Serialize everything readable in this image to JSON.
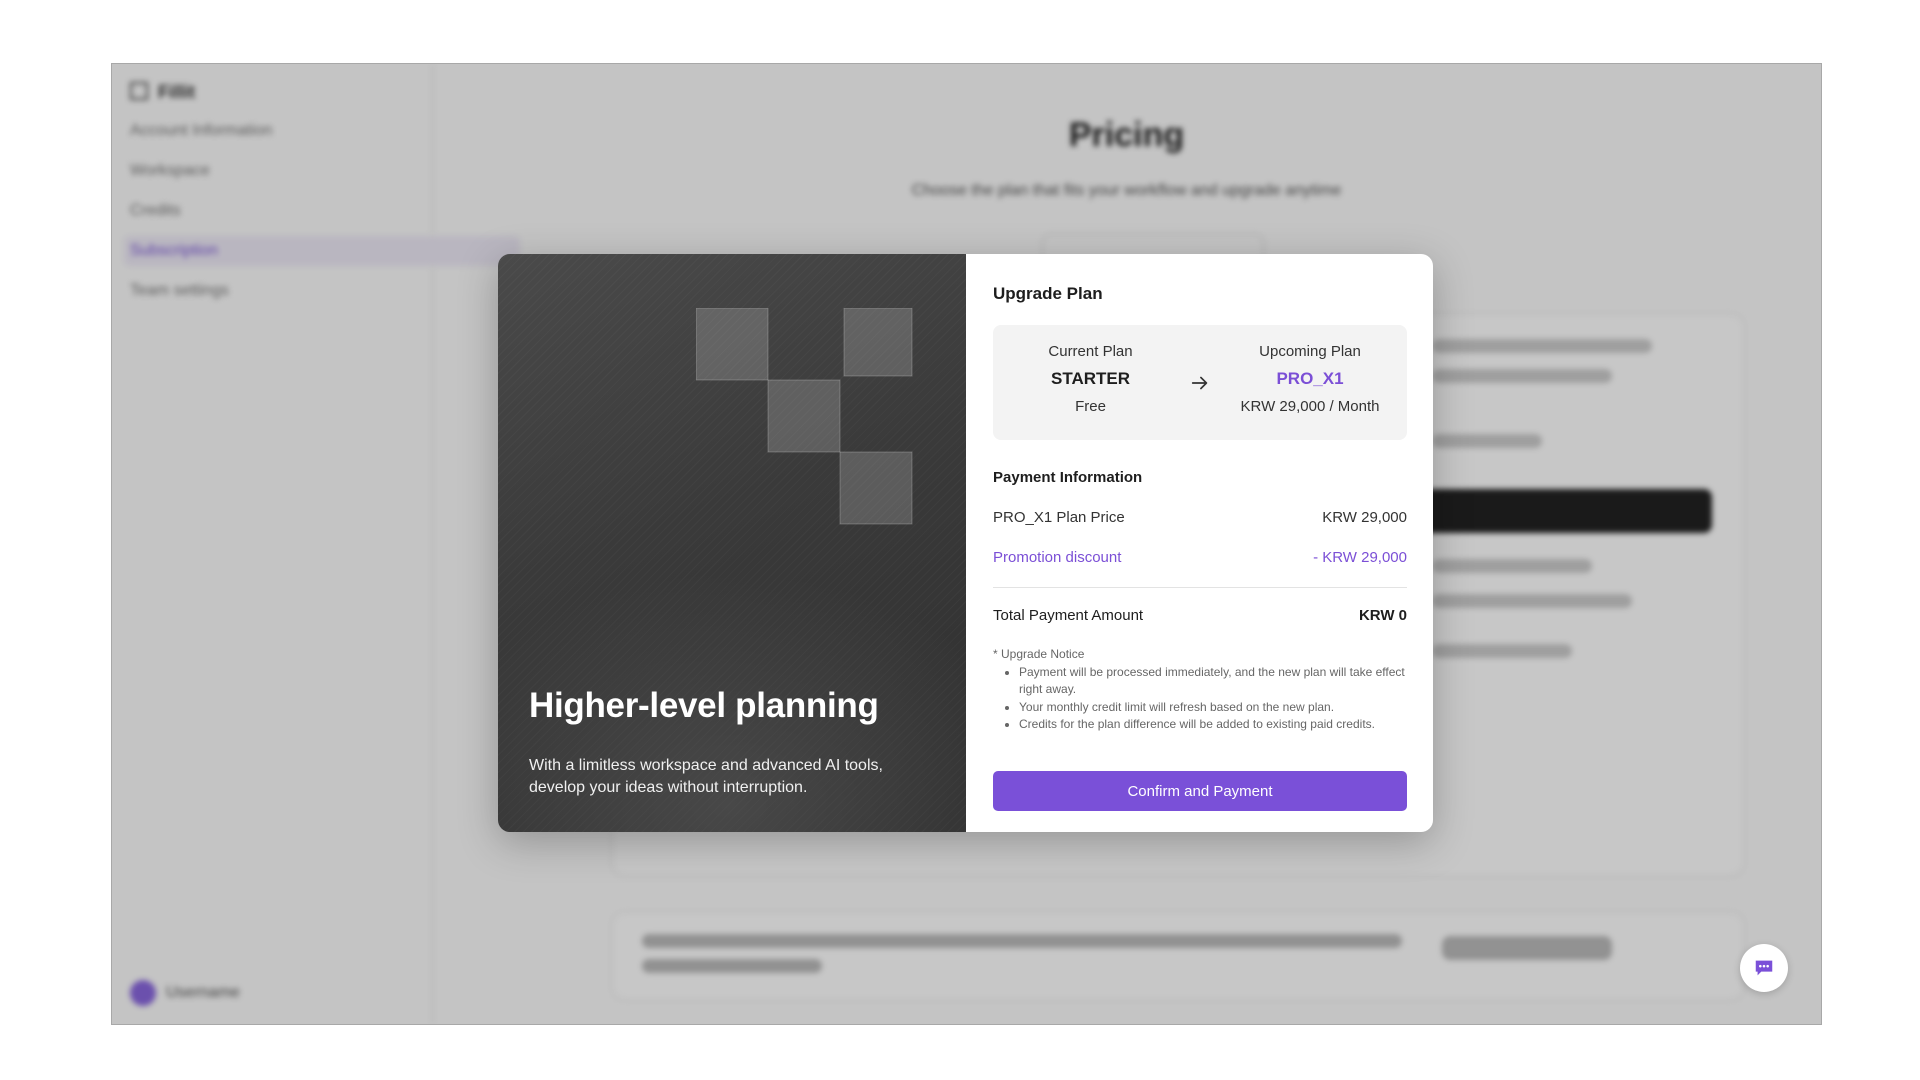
{
  "background": {
    "app_name": "Fillit",
    "sidebar_items": [
      "Account Information",
      "Workspace",
      "Credits",
      "Subscription",
      "Team settings"
    ],
    "footer_user": "Username",
    "page_title": "Pricing",
    "page_subtitle": "Choose the plan that fits your workflow and upgrade anytime"
  },
  "modal": {
    "hero": {
      "title": "Higher-level planning",
      "description": "With a limitless workspace and advanced AI tools, develop your ideas without interruption."
    },
    "title": "Upgrade Plan",
    "current_plan": {
      "label": "Current Plan",
      "name": "STARTER",
      "price": "Free"
    },
    "upcoming_plan": {
      "label": "Upcoming Plan",
      "name": "PRO_X1",
      "price": "KRW 29,000 / Month"
    },
    "payment_info": {
      "title": "Payment Information",
      "plan_price_label": "PRO_X1 Plan Price",
      "plan_price_value": "KRW 29,000",
      "discount_label": "Promotion discount",
      "discount_value": "- KRW 29,000",
      "total_label": "Total Payment Amount",
      "total_value": "KRW 0"
    },
    "notice": {
      "title": "* Upgrade Notice",
      "items": [
        "Payment will be processed immediately, and the new plan will take effect right away.",
        "Your monthly credit limit will refresh based on the new plan.",
        "Credits for the plan difference will be added to existing paid credits."
      ]
    },
    "confirm_label": "Confirm and Payment"
  },
  "colors": {
    "accent": "#7a50d8",
    "hero_bg": "#3a3a3a"
  },
  "icons": {
    "arrow": "arrow-right-icon",
    "chat": "chat-bubble-icon",
    "logo": "brand-mark-icon"
  }
}
